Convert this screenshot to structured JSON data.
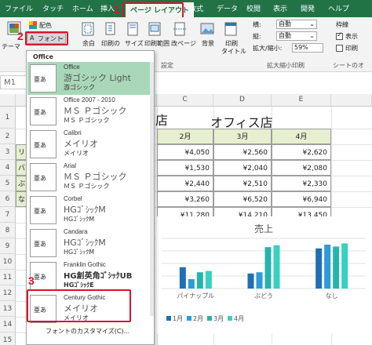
{
  "tabs": [
    "ファイル",
    "タッチ",
    "ホーム",
    "挿入",
    "ページ レイアウト",
    "数式",
    "データ",
    "校閲",
    "表示",
    "開発",
    "ヘルプ"
  ],
  "ribbon": {
    "theme_label": "テーマ",
    "colors_label": "配色",
    "fonts_label": "フォント",
    "buttons": [
      "余白",
      "印刷の",
      "サイズ",
      "印刷範囲",
      "改ページ",
      "背景",
      "印刷",
      "タイトル"
    ],
    "group_setup": "設定",
    "scale": {
      "width_label": "横:",
      "width_value": "自動",
      "height_label": "縦:",
      "height_value": "自動",
      "zoom_label": "拡大/縮小:",
      "zoom_value": "59%"
    },
    "group_scale": "拡大縮小印刷",
    "gridlines_label": "枠線",
    "view_label": "表示",
    "print_label": "印刷",
    "group_sheet": "シートのオ"
  },
  "callouts": [
    "1",
    "2",
    "3"
  ],
  "namebox": "M1",
  "sheet": {
    "columns": [
      "C",
      "D",
      "E"
    ],
    "rows": [
      "1",
      "2",
      "3",
      "4",
      "5",
      "6",
      "7",
      "8",
      "9",
      "10",
      "11",
      "12",
      "13",
      "14",
      "15",
      "16"
    ],
    "title_left": "店",
    "title_right": "オフィス店",
    "month_headers": [
      "2月",
      "3月",
      "4月"
    ],
    "row_labels": [
      "リ",
      "バ",
      "ぶ",
      "な"
    ],
    "values": [
      [
        "¥4,050",
        "¥2,560",
        "¥2,620"
      ],
      [
        "¥1,530",
        "¥2,040",
        "¥2,080"
      ],
      [
        "¥2,440",
        "¥2,510",
        "¥2,330"
      ],
      [
        "¥3,260",
        "¥6,520",
        "¥6,940"
      ],
      [
        "¥11,280",
        "¥14,210",
        "¥13,450"
      ]
    ]
  },
  "chart_data": {
    "type": "bar",
    "title": "売上",
    "categories": [
      "パイナップル",
      "ぶどう",
      "なし"
    ],
    "series": [
      {
        "name": "1月",
        "values": [
          3.4,
          2.4,
          6.4
        ],
        "color": "#1f6fb5"
      },
      {
        "name": "2月",
        "values": [
          1.5,
          2.6,
          7.0
        ],
        "color": "#2e9ad6"
      },
      {
        "name": "3月",
        "values": [
          2.6,
          6.6,
          6.7
        ],
        "color": "#27b3ad"
      },
      {
        "name": "4月",
        "values": [
          2.8,
          6.9,
          7.2
        ],
        "color": "#38d0c0"
      }
    ],
    "ylim": [
      0,
      8
    ]
  },
  "dropdown": {
    "header": "Office",
    "thumb_text": "亜あ",
    "items": [
      {
        "name": "Office",
        "major": "游ゴシック Light",
        "minor": "游ゴシック"
      },
      {
        "name": "Office 2007 - 2010",
        "major": "ＭＳ Ｐゴシック",
        "minor": "ＭＳ Ｐゴシック"
      },
      {
        "name": "Calibri",
        "major": "メイリオ",
        "minor": "メイリオ"
      },
      {
        "name": "Arial",
        "major": "ＭＳ Ｐゴシック",
        "minor": "ＭＳ Ｐゴシック"
      },
      {
        "name": "Corbel",
        "major": "HGｺﾞｼｯｸM",
        "minor": "HGｺﾞｼｯｸM"
      },
      {
        "name": "Candara",
        "major": "HGｺﾞｼｯｸM",
        "minor": "HGｺﾞｼｯｸM"
      },
      {
        "name": "Franklin Gothic",
        "major": "HG創英角ｺﾞｼｯｸUB",
        "minor": "HGｺﾞｼｯｸE"
      },
      {
        "name": "Century Gothic",
        "major": "メイリオ",
        "minor": "メイリオ"
      }
    ],
    "footer": "フォントのカスタマイズ(C)..."
  },
  "colors": {
    "excel_green": "#217346",
    "callout_red": "#d7152d",
    "highlight": "#a8d8b9",
    "header_fill": "#e6efcf"
  }
}
